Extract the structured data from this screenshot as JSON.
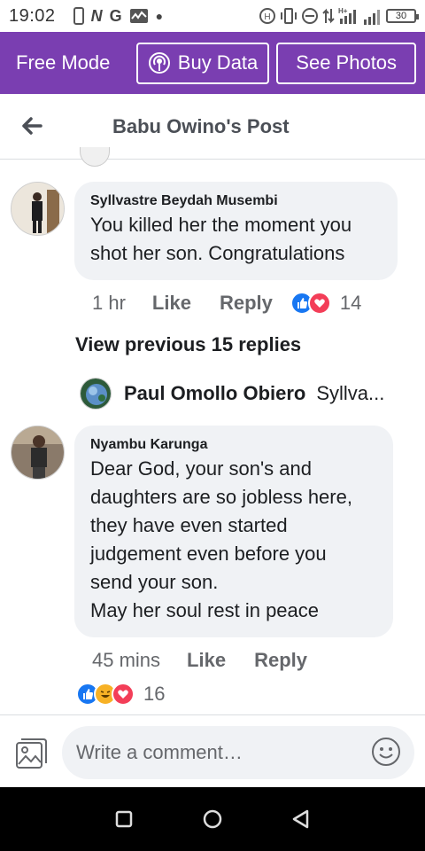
{
  "status_bar": {
    "time": "19:02",
    "battery": "30",
    "icons": [
      "phone-icon",
      "n-icon",
      "g-icon",
      "activity-icon",
      "dot-icon",
      "nfc-icon",
      "vibrate-icon",
      "dnd-icon",
      "data-arrows-icon",
      "signal-icon",
      "signal-icon-2",
      "battery-icon"
    ]
  },
  "free_bar": {
    "label": "Free Mode",
    "buy_data": "Buy Data",
    "see_photos": "See Photos",
    "background": "#7a3eb1"
  },
  "header": {
    "title": "Babu Owino's Post"
  },
  "comments": [
    {
      "name": "Syllvastre Beydah Musembi",
      "lines": [
        "You killed her the moment you",
        "shot her son. Congratulations"
      ],
      "time": "1 hr",
      "like": "Like",
      "reply": "Reply",
      "reaction_count": "14",
      "reactions": [
        "like",
        "love"
      ]
    },
    {
      "name": "Nyambu Karunga",
      "lines": [
        "Dear God, your son's and",
        "daughters are so jobless here,",
        "they have even started",
        "judgement even before you",
        "send your son.",
        "May her soul rest in peace"
      ],
      "time": "45 mins",
      "like": "Like",
      "reply": "Reply",
      "reaction_count": "16",
      "reactions": [
        "like",
        "haha",
        "love"
      ]
    }
  ],
  "view_previous": "View previous 15 replies",
  "reply_preview": {
    "name": "Paul Omollo Obiero",
    "text": "Syllva..."
  },
  "composer": {
    "placeholder": "Write a comment…"
  },
  "colors": {
    "like_blue": "#1877f2",
    "love_red": "#f33e58",
    "haha_yellow": "#f7b125",
    "bubble_gray": "#f0f2f5"
  }
}
